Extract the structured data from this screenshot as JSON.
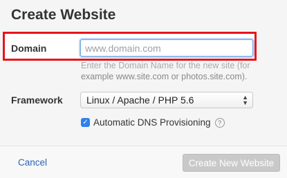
{
  "dialog": {
    "title": "Create Website"
  },
  "domain": {
    "label": "Domain",
    "value": "",
    "placeholder": "www.domain.com",
    "help_line1": "Enter the Domain Name for the new site (for",
    "help_line2": "example www.site.com or photos.site.com)."
  },
  "framework": {
    "label": "Framework",
    "selected": "Linux / Apache / PHP 5.6"
  },
  "dns": {
    "label": "Automatic DNS Provisioning",
    "checked": true
  },
  "footer": {
    "cancel_label": "Cancel",
    "create_label": "Create New Website"
  },
  "colors": {
    "highlight_border": "#e8131b",
    "accent": "#2f80ed",
    "link": "#2d63b8",
    "disabled_button": "#c9c9c9"
  },
  "icons": {
    "select_arrows": "up-down-chevron-icon",
    "checkbox": "checkmark-icon",
    "help": "question-circle-icon"
  }
}
